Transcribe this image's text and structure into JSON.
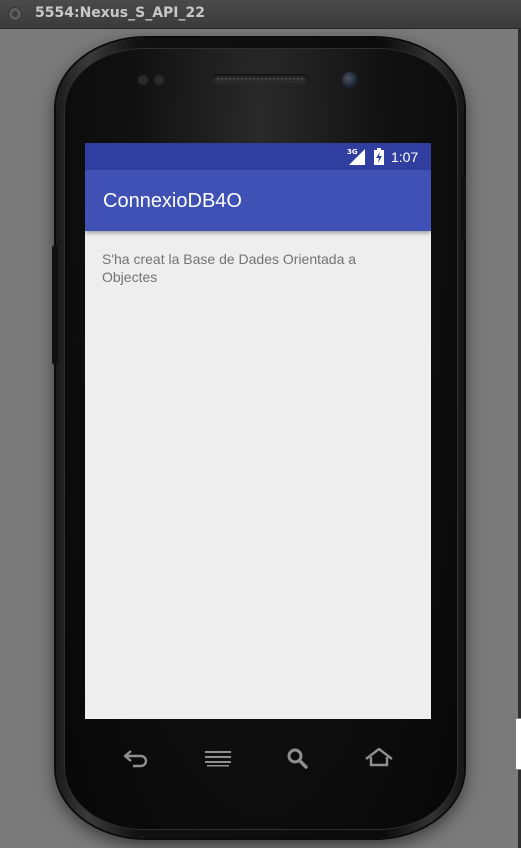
{
  "window": {
    "title": "5554:Nexus_S_API_22"
  },
  "status_bar": {
    "network": "3G",
    "time": "1:07"
  },
  "app_bar": {
    "title": "ConnexioDB4O"
  },
  "content": {
    "message": "S'ha creat la Base de Dades Orientada a Objectes"
  },
  "nav_buttons": [
    {
      "icon": "back-icon"
    },
    {
      "icon": "menu-icon"
    },
    {
      "icon": "search-icon"
    },
    {
      "icon": "home-icon"
    }
  ],
  "colors": {
    "status_bar": "#303f9f",
    "app_bar": "#3f51b5",
    "content_bg": "#eeeeee",
    "content_text": "#737373"
  }
}
